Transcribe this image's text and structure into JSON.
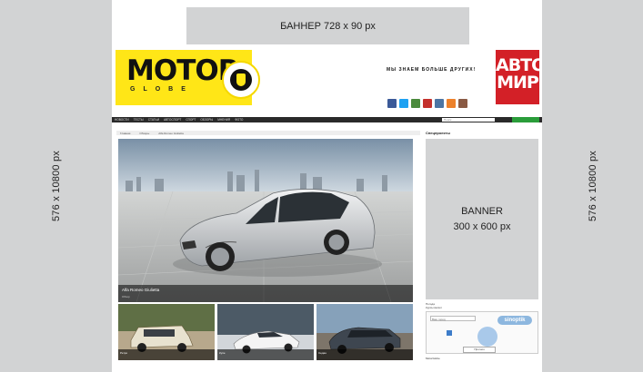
{
  "left_side": {
    "label": "576 x 10800 px"
  },
  "right_side": {
    "label": "576 x 10800 px"
  },
  "top_banner": {
    "label": "БАННЕР 728 x 90 px"
  },
  "logo": {
    "word": "MOTOR",
    "sub": "GLOBE"
  },
  "header": {
    "slogan": "МЫ ЗНАЕМ БОЛЬШЕ ДРУГИХ!"
  },
  "partner": {
    "line1": "АВТО",
    "line2": "МИР"
  },
  "social_icons": [
    {
      "name": "facebook-icon",
      "color": "#3b5998"
    },
    {
      "name": "twitter-icon",
      "color": "#1da1f2"
    },
    {
      "name": "gplus-icon",
      "color": "#4a8a3c"
    },
    {
      "name": "youtube-icon",
      "color": "#c4302b"
    },
    {
      "name": "vk-icon",
      "color": "#4c75a3"
    },
    {
      "name": "odnoklassniki-icon",
      "color": "#ed812b"
    },
    {
      "name": "instagram-icon",
      "color": "#8a5a44"
    }
  ],
  "nav": {
    "items": [
      "НОВОСТИ",
      "ТЕСТЫ",
      "СТАТЬИ",
      "АВТОСПОРТ",
      "СПОРТ",
      "ОБЗОРЫ",
      "МНЕНИЯ",
      "ФОТО"
    ],
    "search_placeholder": "Поиск...",
    "accent": "#2a9d3a"
  },
  "breadcrumbs": [
    "Главная",
    "Обзоры",
    "Alfa Romeo Giulietta"
  ],
  "sidebar_title": "Спецпроекты",
  "right_banner": {
    "line1": "BANNER",
    "line2": "300 x 600 px"
  },
  "hero": {
    "caption_title": "Alfa Romeo Giulietta",
    "caption_sub": "Обзор"
  },
  "thumbs": [
    {
      "caption": "Ретро"
    },
    {
      "caption": "Купе"
    },
    {
      "caption": "Седан"
    }
  ],
  "widget": {
    "field": "Ваш город",
    "brand": "sinoptik",
    "button": "Прогноз"
  },
  "right_side_lines": [
    "Погода",
    "Курсы валют"
  ],
  "bottom_text": "MotorGlobe"
}
